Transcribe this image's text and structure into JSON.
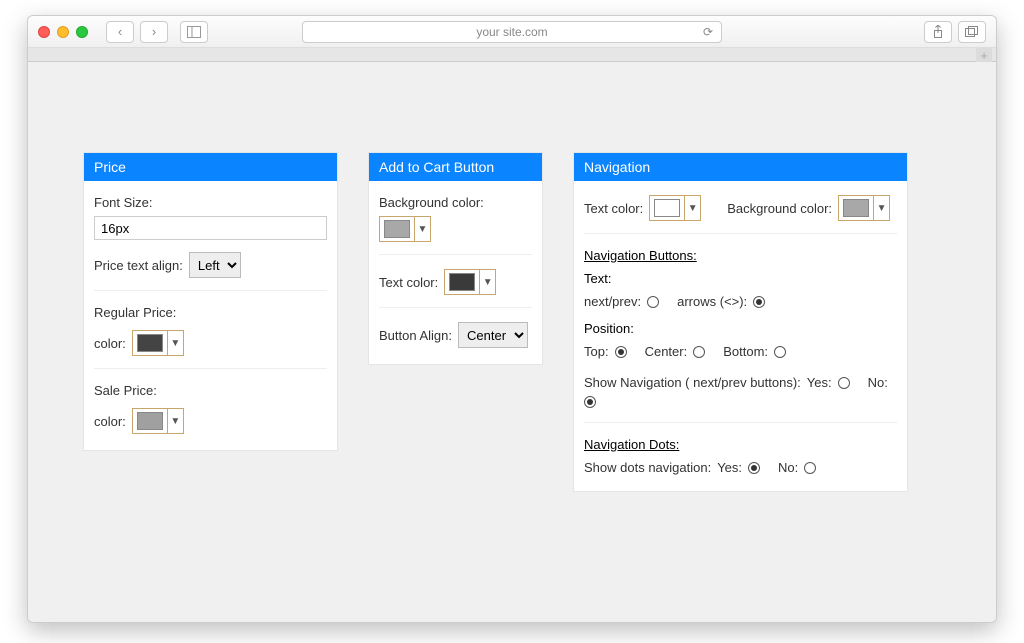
{
  "browser": {
    "url": "your site.com"
  },
  "panels": {
    "price": {
      "title": "Price",
      "font_size_label": "Font Size:",
      "font_size_value": "16px",
      "align_label": "Price text align:",
      "align_value": "Left",
      "regular_label": "Regular Price:",
      "sale_label": "Sale Price:",
      "color_label": "color:",
      "regular_color": "#444444",
      "sale_color": "#a0a0a0"
    },
    "cart": {
      "title": "Add to Cart Button",
      "bg_label": "Background color:",
      "bg_color": "#a8a8a8",
      "text_label": "Text color:",
      "text_color": "#3a3a3a",
      "align_label": "Button Align:",
      "align_value": "Center"
    },
    "nav": {
      "title": "Navigation",
      "text_label": "Text color:",
      "text_color": "#ffffff",
      "bg_label": "Background color:",
      "bg_color": "#a8a8a8",
      "buttons_hdr": "Navigation Buttons:",
      "text_hdr": "Text:",
      "opt_nextprev": "next/prev:",
      "opt_arrows": "arrows (<>):",
      "position_hdr": "Position:",
      "pos_top": "Top:",
      "pos_center": "Center:",
      "pos_bottom": "Bottom:",
      "show_nav_label": "Show Navigation ( next/prev buttons):",
      "yes": "Yes:",
      "no": "No:",
      "dots_hdr": "Navigation Dots:",
      "show_dots_label": "Show dots navigation:",
      "text_selected": "arrows",
      "position_selected": "top",
      "show_nav_selected": "no",
      "show_dots_selected": "yes"
    }
  }
}
